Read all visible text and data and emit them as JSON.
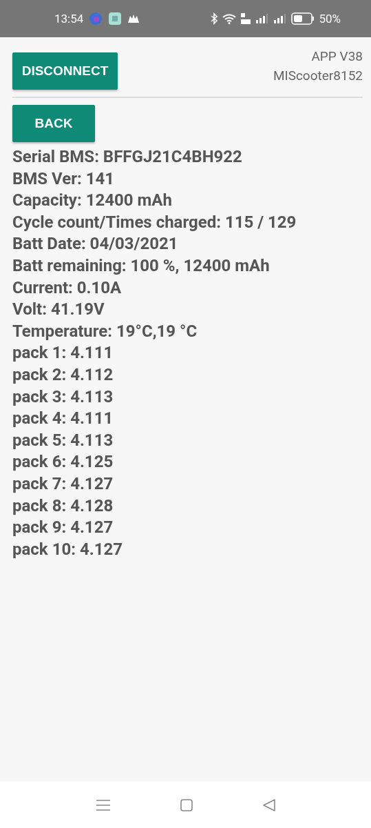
{
  "status_bar": {
    "time": "13:54",
    "battery": "50%"
  },
  "header": {
    "disconnect": "DISCONNECT",
    "app_version": "APP V38",
    "device": "MIScooter8152"
  },
  "back": "BACK",
  "info_lines": [
    "Serial BMS: BFFGJ21C4BH922",
    "BMS Ver: 141",
    "Capacity: 12400 mAh",
    "Cycle count/Times charged: 115 / 129",
    "Batt Date: 04/03/2021",
    "Batt remaining: 100 %, 12400 mAh",
    "Current: 0.10A",
    "Volt: 41.19V",
    "Temperature: 19°C,19 °C",
    "pack 1: 4.111",
    "pack 2: 4.112",
    "pack 3: 4.113",
    "pack 4: 4.111",
    "pack 5: 4.113",
    "pack 6: 4.125",
    "pack 7: 4.127",
    "pack 8: 4.128",
    "pack 9: 4.127",
    "pack 10: 4.127"
  ]
}
